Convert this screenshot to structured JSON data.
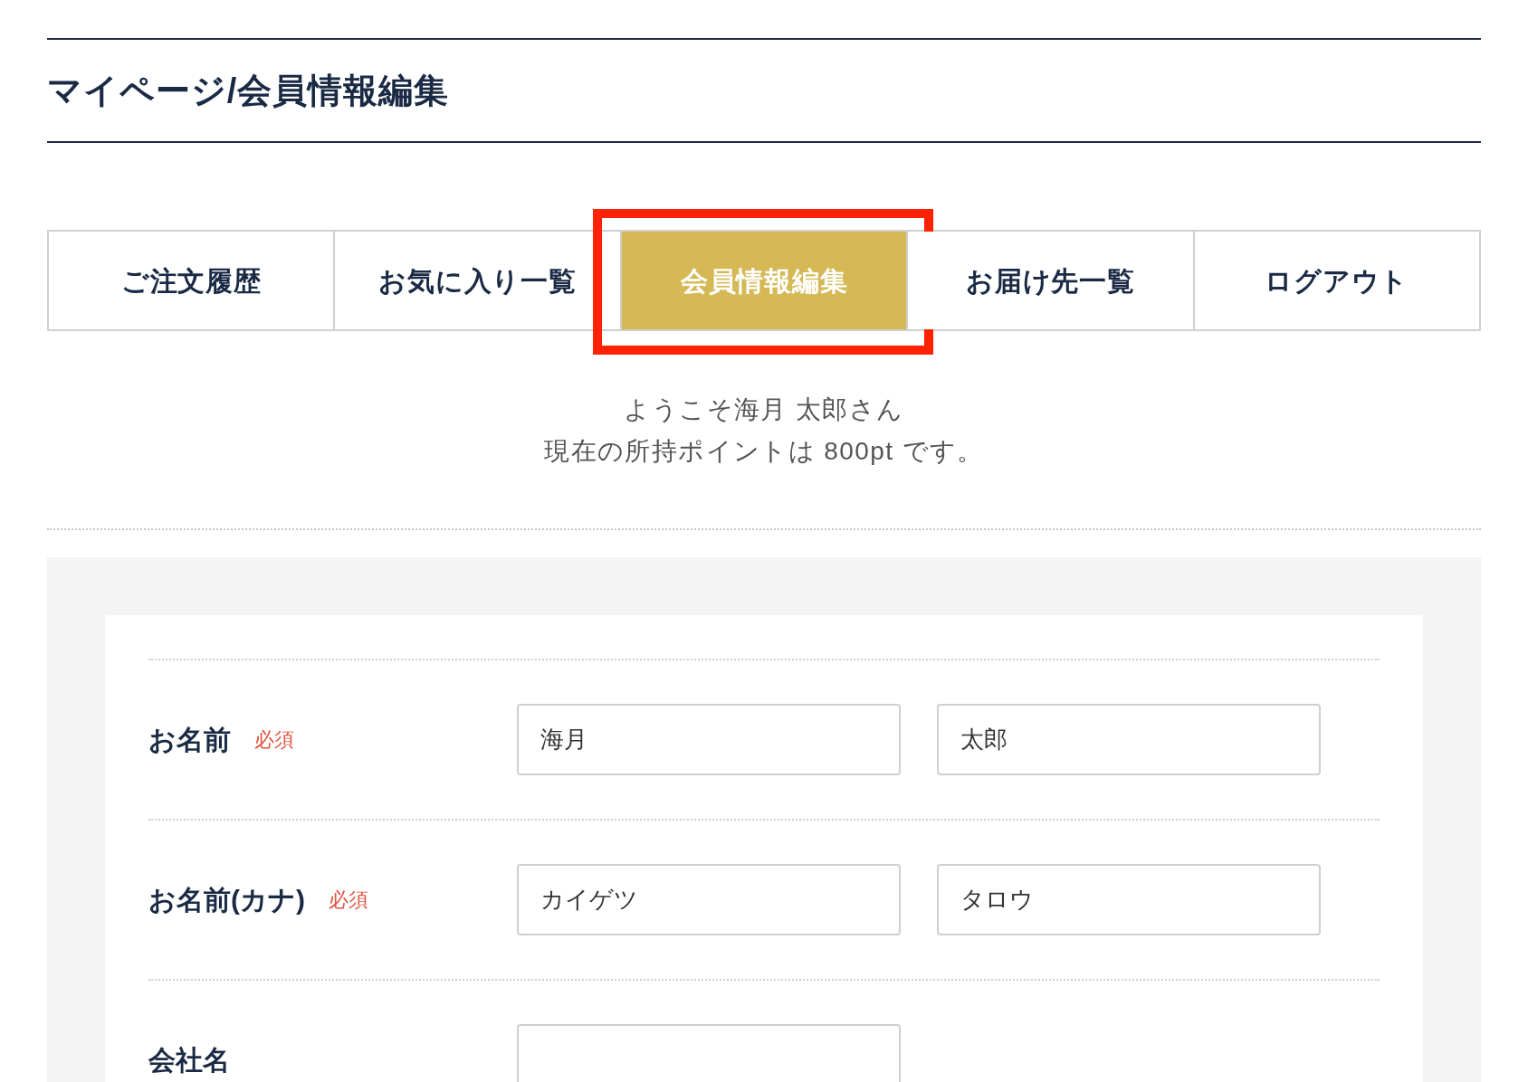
{
  "page_title": "マイページ/会員情報編集",
  "tabs": [
    {
      "label": "ご注文履歴",
      "selected": false
    },
    {
      "label": "お気に入り一覧",
      "selected": false
    },
    {
      "label": "会員情報編集",
      "selected": true
    },
    {
      "label": "お届け先一覧",
      "selected": false
    },
    {
      "label": "ログアウト",
      "selected": false
    }
  ],
  "welcome": [
    "ようこそ海月 太郎さん",
    "現在の所持ポイントは 800pt です。"
  ],
  "form": {
    "rows": [
      {
        "label": "お名前",
        "required": true,
        "required_label": "必須",
        "fields": [
          {
            "kind": "text",
            "value": "海月"
          },
          {
            "kind": "text",
            "value": "太郎"
          }
        ]
      },
      {
        "label": "お名前(カナ)",
        "required": true,
        "required_label": "必須",
        "fields": [
          {
            "kind": "text",
            "value": "カイゲツ"
          },
          {
            "kind": "text",
            "value": "タロウ"
          }
        ]
      },
      {
        "label": "会社名",
        "required": false,
        "fields": [
          {
            "kind": "text"
          }
        ]
      }
    ]
  }
}
